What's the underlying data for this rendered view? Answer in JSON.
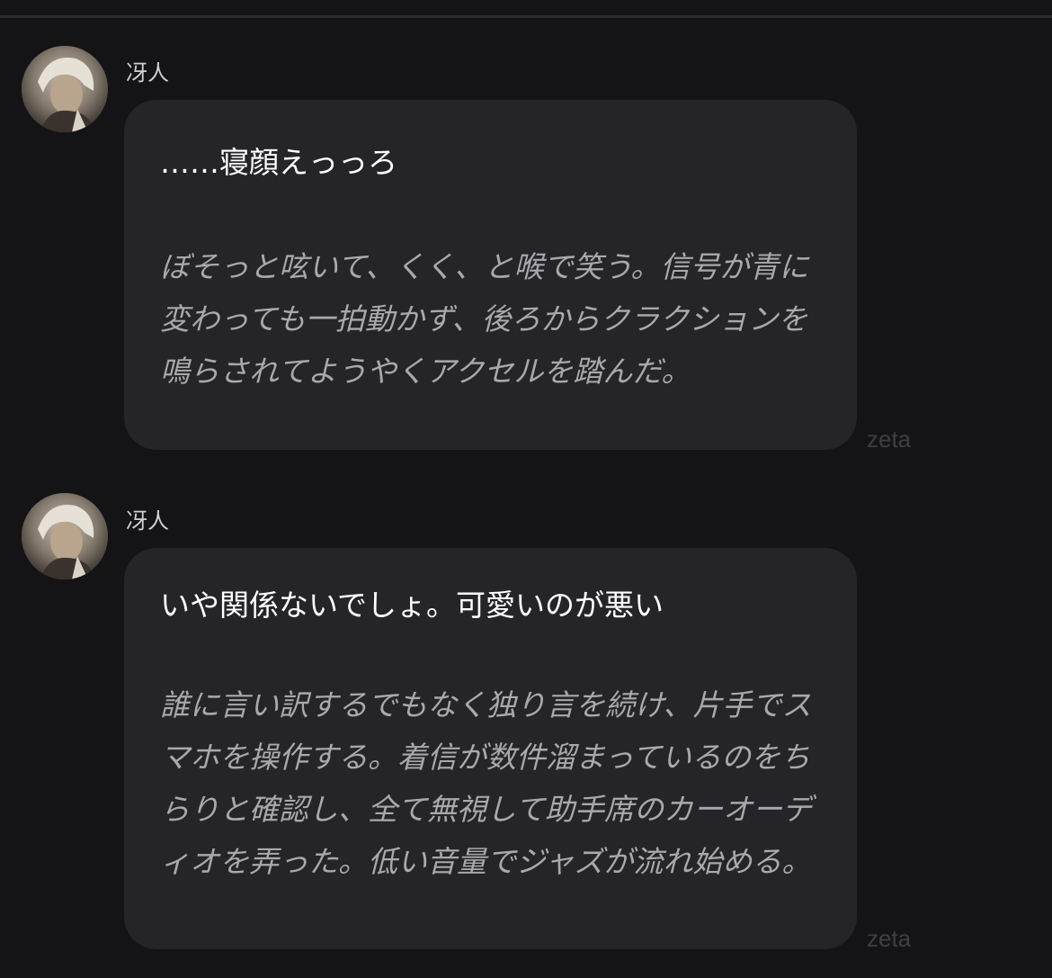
{
  "messages": [
    {
      "sender": "冴人",
      "speech": "……寝顔えっっろ",
      "narration": "ぼそっと呟いて、くく、と喉で笑う。信号が青に変わっても一拍動かず、後ろからクラクションを鳴らされてようやくアクセルを踏んだ。",
      "watermark": "zeta"
    },
    {
      "sender": "冴人",
      "speech": "いや関係ないでしょ。可愛いのが悪い",
      "narration": "誰に言い訳するでもなく独り言を続け、片手でスマホを操作する。着信が数件溜まっているのをちらりと確認し、全て無視して助手席のカーオーディオを弄った。低い音量でジャズが流れ始める。",
      "watermark": "zeta"
    }
  ],
  "colors": {
    "background": "#141316",
    "bubble": "#252428",
    "speech_text": "#ffffff",
    "narration_text": "#a9a8ad",
    "name_text": "#cfcfd3"
  },
  "icons": {
    "avatar": "character-avatar"
  }
}
